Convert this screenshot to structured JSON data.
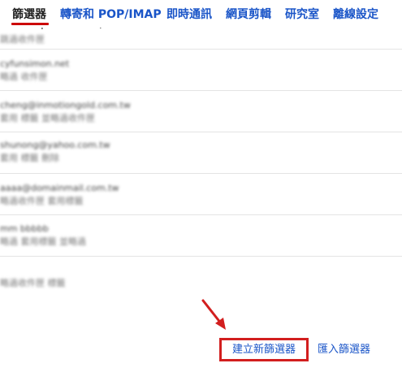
{
  "tabs": [
    {
      "label": "篩選器",
      "active": true
    },
    {
      "label": "轉寄和 POP/IMAP",
      "active": false
    },
    {
      "label": "即時通訊",
      "active": false
    },
    {
      "label": "網頁剪輯",
      "active": false
    },
    {
      "label": "研究室",
      "active": false
    },
    {
      "label": "離線設定",
      "active": false
    }
  ],
  "colors": {
    "link": "#1a55c8",
    "active_tab_text": "#222222",
    "active_tab_underline": "#cc0000",
    "highlight_border": "#d21e1e",
    "arrow": "#d21e1e",
    "row_divider": "#e4e4e4"
  },
  "filter_list": {
    "clipped_top_text": "subscriptions.com)",
    "rows": [
      {
        "lines": [
          "跳過收件匣"
        ]
      },
      {
        "lines": [
          "cyfunsimon.net",
          "略過 收件匣"
        ]
      },
      {
        "lines": [
          "cheng@inmotiongold.com.tw",
          "套用 標籤 並略過收件匣"
        ]
      },
      {
        "lines": [
          "shunong@yahoo.com.tw",
          "套用 標籤 刪除"
        ]
      },
      {
        "lines": [
          "aaaa@domainmail.com.tw",
          "略過收件匣 套用標籤"
        ]
      },
      {
        "lines": [
          "mm bbbbb",
          "略過 套用標籤 並略過"
        ]
      },
      {
        "lines": [
          "略過收件匣 標籤"
        ]
      }
    ]
  },
  "actions": {
    "create_filter": "建立新篩選器",
    "import_filters": "匯入篩選器"
  }
}
